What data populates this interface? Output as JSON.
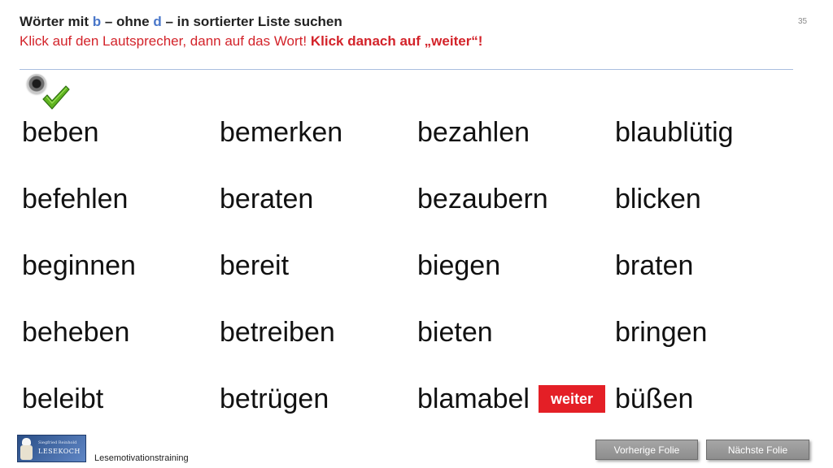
{
  "header": {
    "title_parts": {
      "p1": "Wörter mit ",
      "b": "b",
      "p2": " – ohne ",
      "d": "d",
      "p3": " – in sortierter Liste suchen"
    },
    "instruction_normal": "Klick auf den Lautsprecher, dann auf das Wort! ",
    "instruction_bold": "Klick danach auf „weiter“!",
    "slide_number": "35"
  },
  "colors": {
    "title_highlight": "#4a77c9",
    "instruction_red": "#d3232a",
    "weiter_button_bg": "#e41f26",
    "nav_button_bg": "#999999"
  },
  "icons": {
    "speaker": "speaker-icon",
    "checkmark": "checkmark-icon"
  },
  "words": {
    "col1": [
      "beben",
      "befehlen",
      "beginnen",
      "beheben",
      "beleibt"
    ],
    "col2": [
      "bemerken",
      "beraten",
      "bereit",
      "betreiben",
      "betrügen"
    ],
    "col3": [
      "bezahlen",
      "bezaubern",
      "biegen",
      "bieten",
      "blamabel"
    ],
    "col4": [
      "blaublütig",
      "blicken",
      "braten",
      "bringen",
      "büßen"
    ]
  },
  "weiter_label": "weiter",
  "footer": {
    "logo_small": "Siegfried Reinhold",
    "logo_main": "LESEKOCH",
    "label": "Lesemotivationstraining",
    "prev_label": "Vorherige  Folie",
    "next_label": "Nächste  Folie"
  }
}
